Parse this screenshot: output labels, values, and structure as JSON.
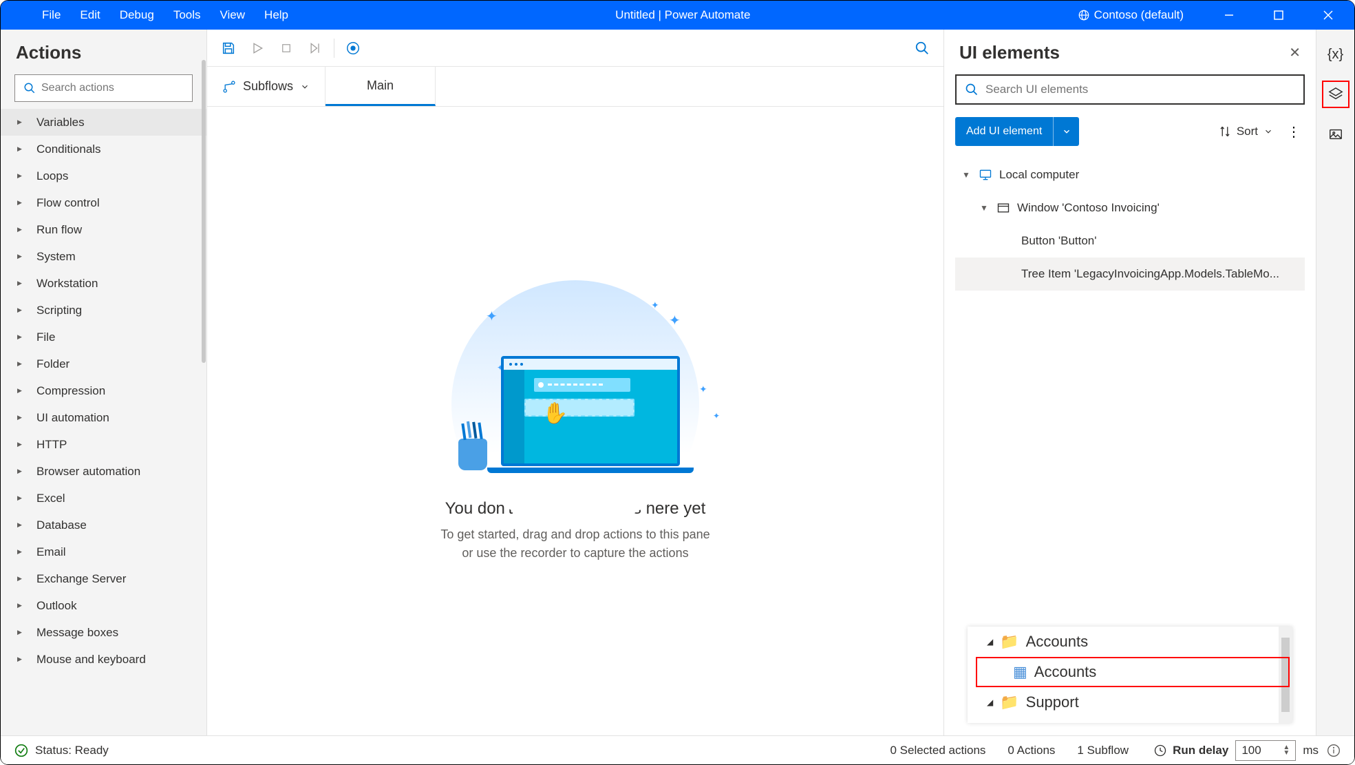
{
  "titlebar": {
    "menus": [
      "File",
      "Edit",
      "Debug",
      "Tools",
      "View",
      "Help"
    ],
    "title": "Untitled | Power Automate",
    "environment": "Contoso (default)"
  },
  "actions": {
    "title": "Actions",
    "search_placeholder": "Search actions",
    "items": [
      "Variables",
      "Conditionals",
      "Loops",
      "Flow control",
      "Run flow",
      "System",
      "Workstation",
      "Scripting",
      "File",
      "Folder",
      "Compression",
      "UI automation",
      "HTTP",
      "Browser automation",
      "Excel",
      "Database",
      "Email",
      "Exchange Server",
      "Outlook",
      "Message boxes",
      "Mouse and keyboard"
    ]
  },
  "tabs": {
    "subflows": "Subflows",
    "main": "Main"
  },
  "canvas": {
    "heading": "You don't have any actions here yet",
    "line1": "To get started, drag and drop actions to this pane",
    "line2": "or use the recorder to capture the actions"
  },
  "ui": {
    "title": "UI elements",
    "search_placeholder": "Search UI elements",
    "add": "Add UI element",
    "sort": "Sort",
    "tree": {
      "root": "Local computer",
      "window": "Window 'Contoso Invoicing'",
      "items": [
        "Button 'Button'",
        "Tree Item 'LegacyInvoicingApp.Models.TableMo..."
      ]
    },
    "preview": {
      "accounts": "Accounts",
      "accounts_sub": "Accounts",
      "support": "Support"
    }
  },
  "status": {
    "ready": "Status: Ready",
    "selected": "0 Selected actions",
    "actions": "0 Actions",
    "subflow": "1 Subflow",
    "rundelay": "Run delay",
    "delay_value": "100",
    "ms": "ms"
  }
}
